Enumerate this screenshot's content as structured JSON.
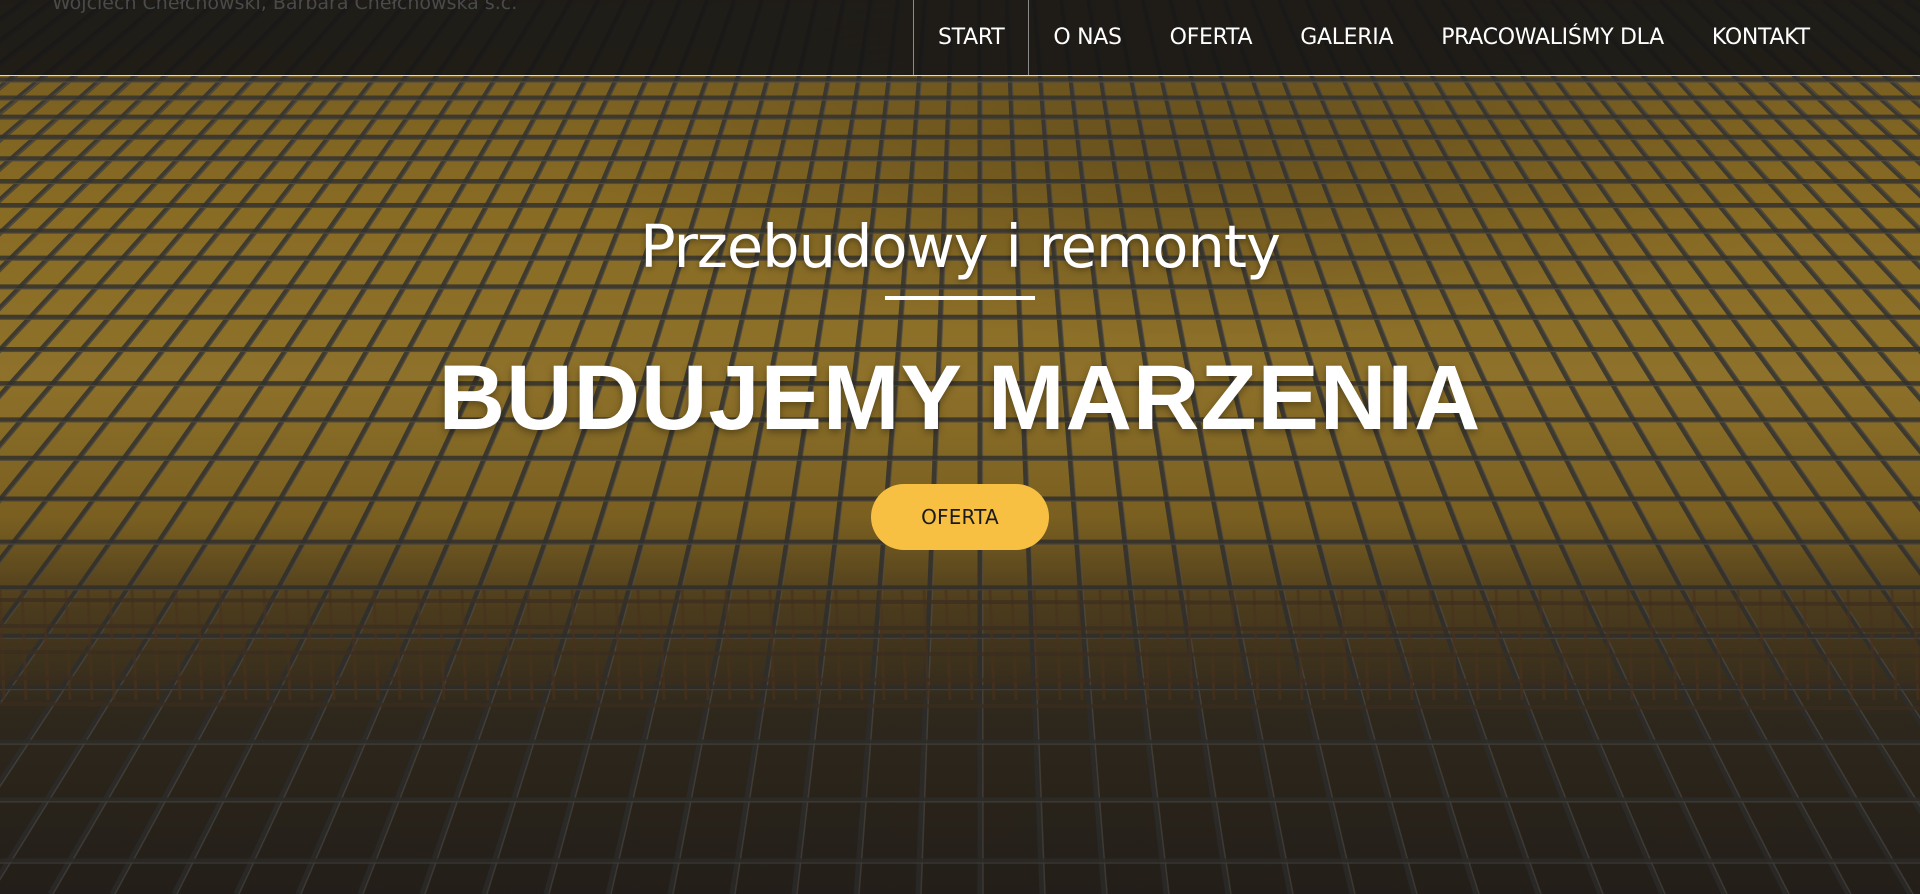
{
  "header": {
    "company_name": "Wojciech Chełchowski, Barbara Chełchowska s.c."
  },
  "nav": {
    "items": [
      {
        "label": "START",
        "active": true
      },
      {
        "label": "O NAS",
        "active": false
      },
      {
        "label": "OFERTA",
        "active": false
      },
      {
        "label": "GALERIA",
        "active": false
      },
      {
        "label": "PRACOWALIŚMY DLA",
        "active": false
      },
      {
        "label": "KONTAKT",
        "active": false
      }
    ]
  },
  "hero": {
    "subtitle": "Przebudowy i remonty",
    "headline": "BUDUJEMY MARZENIA",
    "cta_label": "OFERTA"
  },
  "colors": {
    "accent": "#f7c043",
    "nav_background": "#161616",
    "text_on_dark": "#ffffff"
  }
}
